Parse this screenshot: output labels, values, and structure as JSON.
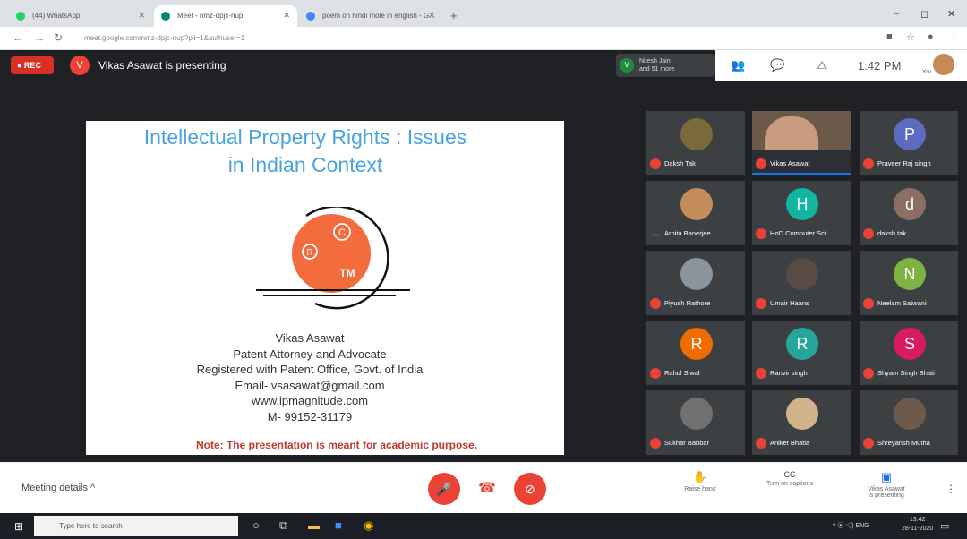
{
  "browser": {
    "tabs": [
      {
        "label": "(44) WhatsApp",
        "fav": "#25d366"
      },
      {
        "label": "Meet - nmz-dpjc-nup",
        "fav": "#00897b"
      },
      {
        "label": "poem on hindi mole in english - G...",
        "fav": "#4285f4"
      }
    ],
    "new_tab": "+",
    "url": "meet.google.com/nmz-dpjc-nup?pli=1&authuser=1",
    "win": {
      "min": "–",
      "max": "◻",
      "close": "✕"
    }
  },
  "meet": {
    "rec_label": "● REC",
    "presenter_initial": "V",
    "presenter_text": "Vikas Asawat is presenting",
    "joined_initial": "V",
    "joined_line1": "Nitesh Jain",
    "joined_line2": "and 51 more",
    "clock": "1:42 PM",
    "you_label": "You"
  },
  "slide": {
    "title_line1": "Intellectual Property Rights : Issues",
    "title_line2": "in Indian Context",
    "logo": {
      "c": "C",
      "r": "R",
      "tm": "TM"
    },
    "name": "Vikas Asawat",
    "role": "Patent Attorney and Advocate",
    "reg": "Registered with Patent Office, Govt. of India",
    "email": "Email- vsasawat@gmail.com",
    "web": "www.ipmagnitude.com",
    "mobile": "M- 99152-31179",
    "note": "Note: The presentation is meant for academic purpose."
  },
  "participants": [
    {
      "name": "Daksh Tak",
      "type": "photo",
      "color": "#7a6a3a",
      "initial": ""
    },
    {
      "name": "Vikas Asawat",
      "type": "cam",
      "color": "",
      "initial": ""
    },
    {
      "name": "Praveer Raj singh",
      "type": "letter",
      "color": "#5c6bc0",
      "initial": "P"
    },
    {
      "name": "Arpita Banerjee",
      "type": "photo",
      "color": "#c48c5a",
      "initial": ""
    },
    {
      "name": "HoD Computer Sci...",
      "type": "letter",
      "color": "#12b5a0",
      "initial": "H"
    },
    {
      "name": "daksh tak",
      "type": "letter",
      "color": "#8d6e63",
      "initial": "d"
    },
    {
      "name": "Piyush Rathore",
      "type": "photo",
      "color": "#8a949c",
      "initial": ""
    },
    {
      "name": "Umair Haans",
      "type": "photo",
      "color": "#5a4a44",
      "initial": ""
    },
    {
      "name": "Neelam Satwani",
      "type": "letter",
      "color": "#7cb342",
      "initial": "N"
    },
    {
      "name": "Rahul Siwal",
      "type": "letter",
      "color": "#ef6c00",
      "initial": "R"
    },
    {
      "name": "Ranvir singh",
      "type": "letter",
      "color": "#26a69a",
      "initial": "R"
    },
    {
      "name": "Shyam Singh Bhati",
      "type": "letter",
      "color": "#d81b60",
      "initial": "S"
    },
    {
      "name": "Sukhar Babbar",
      "type": "photo",
      "color": "#707070",
      "initial": ""
    },
    {
      "name": "Aniket Bhatia",
      "type": "photo",
      "color": "#d2b48c",
      "initial": ""
    },
    {
      "name": "Shreyansh Mutha",
      "type": "photo",
      "color": "#6d5a4a",
      "initial": ""
    }
  ],
  "bottom": {
    "meeting_details": "Meeting details  ^",
    "raise_hand": "Raise hand",
    "captions": "Turn on captions",
    "presenting_line1": "Vikas Asawat",
    "presenting_line2": "is presenting",
    "mic_icon": "🎤",
    "leave_icon": "☎",
    "cam_icon": "⊘",
    "hand_icon": "✋",
    "cc_icon": "CC",
    "present_icon": "▣"
  },
  "taskbar": {
    "search_placeholder": "Type here to search",
    "tray": "^ ⦿ ◁) ENG",
    "time": "13:42",
    "date": "28-11-2020"
  }
}
